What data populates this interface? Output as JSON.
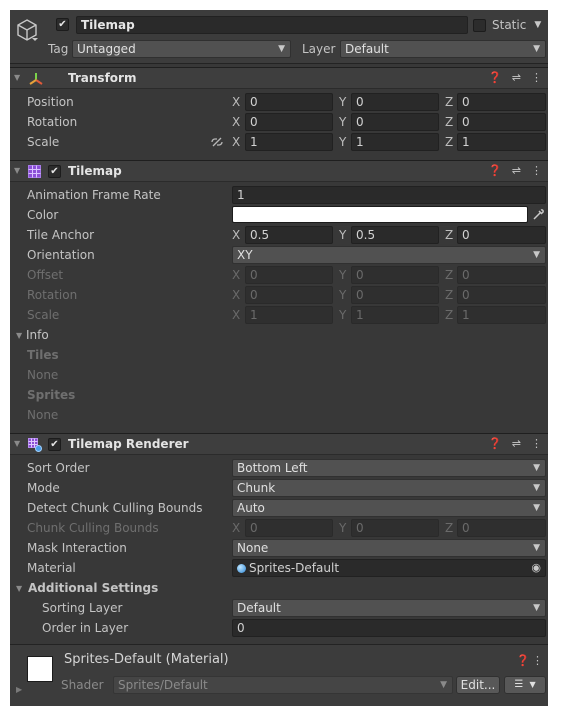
{
  "gameobject": {
    "active_check": "✔",
    "name": "Tilemap",
    "static_label": "Static",
    "tag_label": "Tag",
    "tag_value": "Untagged",
    "layer_label": "Layer",
    "layer_value": "Default"
  },
  "transform": {
    "title": "Transform",
    "rows": [
      {
        "label": "Position",
        "x": "0",
        "y": "0",
        "z": "0"
      },
      {
        "label": "Rotation",
        "x": "0",
        "y": "0",
        "z": "0"
      },
      {
        "label": "Scale",
        "x": "1",
        "y": "1",
        "z": "1"
      }
    ]
  },
  "axes": {
    "x": "X",
    "y": "Y",
    "z": "Z"
  },
  "tilemap": {
    "title": "Tilemap",
    "animation_frame_rate_label": "Animation Frame Rate",
    "animation_frame_rate": "1",
    "color_label": "Color",
    "color_value": "#ffffff",
    "tile_anchor_label": "Tile Anchor",
    "tile_anchor": {
      "x": "0.5",
      "y": "0.5",
      "z": "0"
    },
    "orientation_label": "Orientation",
    "orientation_value": "XY",
    "offset_label": "Offset",
    "offset": {
      "x": "0",
      "y": "0",
      "z": "0"
    },
    "rotation_label": "Rotation",
    "rotation": {
      "x": "0",
      "y": "0",
      "z": "0"
    },
    "scale_label": "Scale",
    "scale": {
      "x": "1",
      "y": "1",
      "z": "1"
    },
    "info_label": "Info",
    "tiles_label": "Tiles",
    "tiles_value": "None",
    "sprites_label": "Sprites",
    "sprites_value": "None"
  },
  "renderer": {
    "title": "Tilemap Renderer",
    "sort_order_label": "Sort Order",
    "sort_order_value": "Bottom Left",
    "mode_label": "Mode",
    "mode_value": "Chunk",
    "detect_label": "Detect Chunk Culling Bounds",
    "detect_value": "Auto",
    "chunk_bounds_label": "Chunk Culling Bounds",
    "chunk_bounds": {
      "x": "0",
      "y": "0",
      "z": "0"
    },
    "mask_label": "Mask Interaction",
    "mask_value": "None",
    "material_label": "Material",
    "material_value": "Sprites-Default",
    "additional_label": "Additional Settings",
    "sorting_layer_label": "Sorting Layer",
    "sorting_layer_value": "Default",
    "order_label": "Order in Layer",
    "order_value": "0"
  },
  "material_footer": {
    "title": "Sprites-Default (Material)",
    "shader_label": "Shader",
    "shader_value": "Sprites/Default",
    "edit_label": "Edit..."
  },
  "icons": {
    "gameobject": "cube-icon",
    "transform": "transform-axes-icon",
    "tilemap": "grid-icon",
    "renderer": "tilemap-renderer-icon"
  }
}
